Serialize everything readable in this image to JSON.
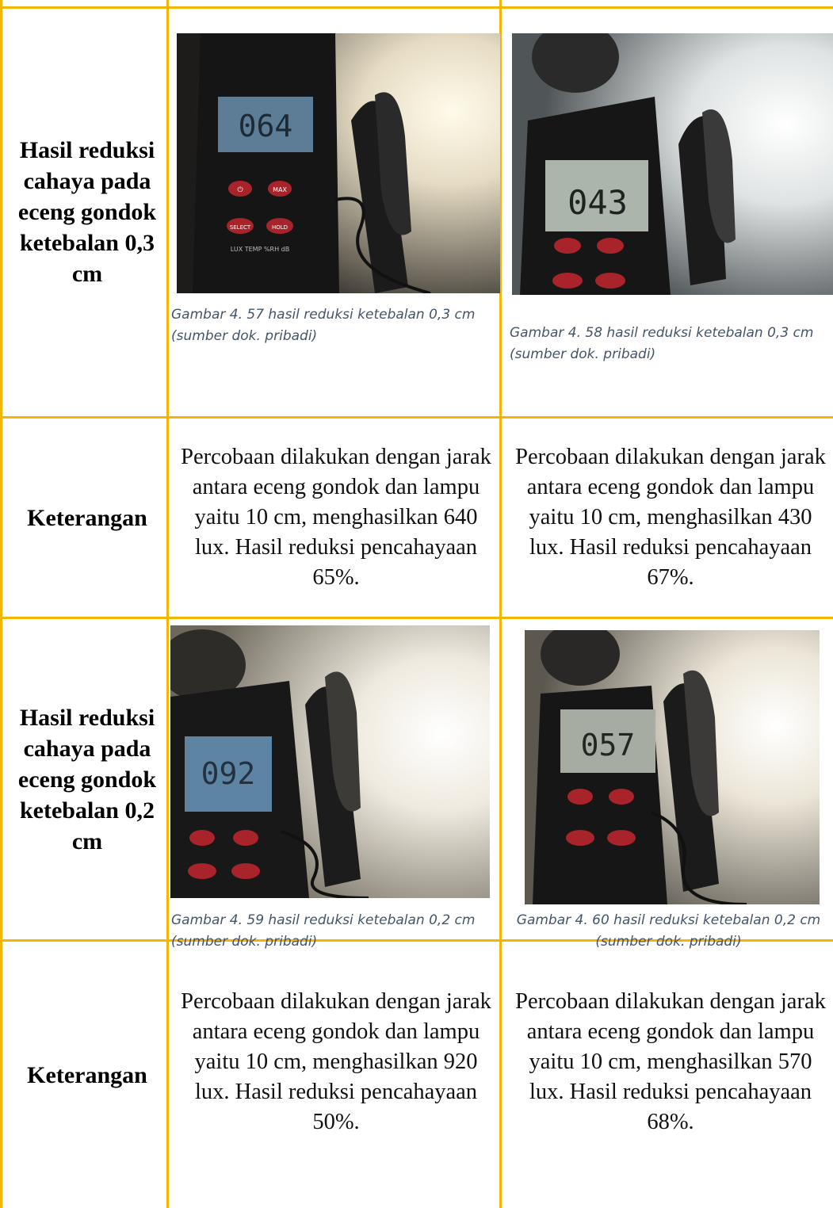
{
  "rows": [
    {
      "header": "Hasil reduksi cahaya pada eceng gondok ketebalan 0,3 cm",
      "figures": [
        {
          "meter_reading": "064",
          "caption": "Gambar 4. 57 hasil reduksi ketebalan 0,3 cm (sumber dok. pribadi)"
        },
        {
          "meter_reading": "043",
          "caption": "Gambar 4. 58 hasil reduksi ketebalan 0,3 cm (sumber dok. pribadi)"
        }
      ]
    },
    {
      "header": "Keterangan",
      "descriptions": [
        "Percobaan dilakukan dengan jarak antara eceng gondok dan lampu yaitu 10 cm, menghasilkan 640 lux. Hasil reduksi pencahayaan 65%.",
        "Percobaan dilakukan dengan jarak antara eceng gondok dan lampu yaitu 10 cm, menghasilkan 430 lux. Hasil reduksi pencahayaan 67%."
      ]
    },
    {
      "header": "Hasil reduksi cahaya pada eceng gondok ketebalan 0,2 cm",
      "figures": [
        {
          "meter_reading": "092",
          "caption": "Gambar 4. 59 hasil reduksi ketebalan 0,2 cm (sumber dok. pribadi)"
        },
        {
          "meter_reading": "057",
          "caption": "Gambar 4. 60 hasil reduksi ketebalan 0,2 cm (sumber dok. pribadi)"
        }
      ]
    },
    {
      "header": "Keterangan",
      "descriptions": [
        "Percobaan dilakukan dengan jarak antara eceng gondok dan lampu yaitu 10 cm, menghasilkan 920 lux. Hasil reduksi pencahayaan 50%.",
        "Percobaan dilakukan dengan jarak antara eceng gondok dan lampu yaitu 10 cm, menghasilkan 570 lux. Hasil reduksi pencahayaan 68%."
      ]
    }
  ],
  "meter_labels": {
    "power": "⏻",
    "max": "MAX",
    "select": "SELECT",
    "hold": "HOLD",
    "modes": "LUX TEMP %RH dB"
  },
  "colors": {
    "table_border": "#f2b705",
    "caption_text": "#44546a",
    "meter_button": "#a8232a"
  }
}
